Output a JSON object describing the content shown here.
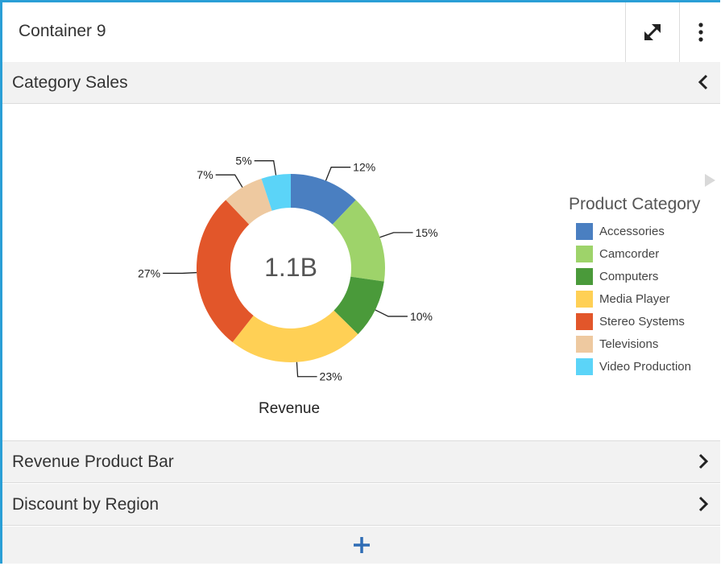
{
  "header": {
    "title": "Container 9",
    "expand_icon": "expand-arrows-icon",
    "menu_icon": "vertical-dots-icon"
  },
  "sections": [
    {
      "label": "Category Sales",
      "state": "expanded",
      "icon": "chevron-left-icon"
    },
    {
      "label": "Revenue Product Bar",
      "state": "collapsed",
      "icon": "chevron-right-icon"
    },
    {
      "label": "Discount by Region",
      "state": "collapsed",
      "icon": "chevron-right-icon"
    }
  ],
  "footer": {
    "add_icon": "plus-icon"
  },
  "chart_data": {
    "type": "pie",
    "style": "donut",
    "center_value": "1.1B",
    "xlabel": "Revenue",
    "legend_title": "Product Category",
    "legend_placement": "right",
    "categories": [
      "Accessories",
      "Camcorder",
      "Computers",
      "Media Player",
      "Stereo Systems",
      "Televisions",
      "Video Production"
    ],
    "values": [
      12,
      15,
      10,
      23,
      27,
      7,
      5
    ],
    "labels": [
      "12%",
      "15%",
      "10%",
      "23%",
      "27%",
      "7%",
      "5%"
    ],
    "colors": [
      "#4a7fc1",
      "#9ed36a",
      "#4a9a3a",
      "#ffd055",
      "#e2562a",
      "#eec9a0",
      "#5bd4f8"
    ]
  }
}
